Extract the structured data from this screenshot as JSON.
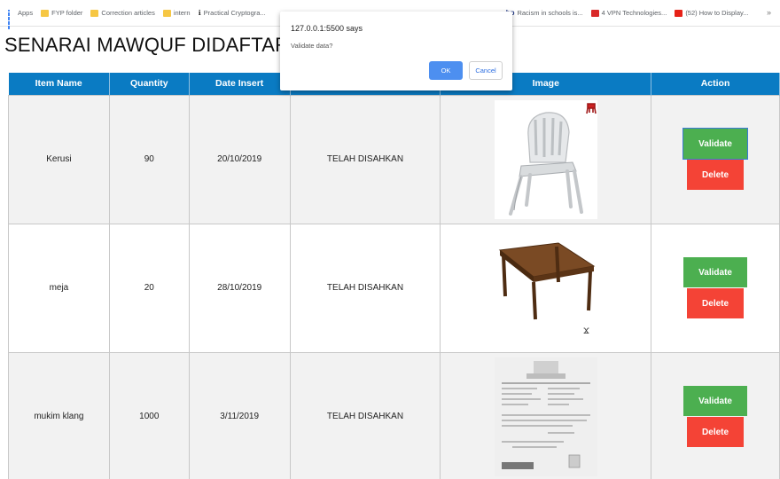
{
  "bookmarks": [
    {
      "label": "Apps",
      "icon": "apps-icon"
    },
    {
      "label": "FYP folder",
      "icon": "folder-icon"
    },
    {
      "label": "Correction articles",
      "icon": "folder-icon"
    },
    {
      "label": "intern",
      "icon": "folder-icon"
    },
    {
      "label": "Practical Cryptogra...",
      "icon": "tk-icon"
    },
    {
      "label": "Racism in schools is...",
      "icon": "bp-icon"
    },
    {
      "label": "4 VPN Technologies...",
      "icon": "it-icon"
    },
    {
      "label": "(52) How to Display...",
      "icon": "youtube-icon"
    }
  ],
  "bookmarks_more": "»",
  "page": {
    "title": "SENARAI MAWQUF DIDAFTAR"
  },
  "table": {
    "headers": [
      "Item Name",
      "Quantity",
      "Date Insert",
      "",
      "Image",
      "Action"
    ],
    "rows": [
      {
        "name": "Kerusi",
        "quantity": "90",
        "date": "20/10/2019",
        "status": "TELAH DISAHKAN",
        "image": "chair"
      },
      {
        "name": "meja",
        "quantity": "20",
        "date": "28/10/2019",
        "status": "TELAH DISAHKAN",
        "image": "table"
      },
      {
        "name": "mukim klang",
        "quantity": "1000",
        "date": "3/11/2019",
        "status": "TELAH DISAHKAN",
        "image": "document"
      }
    ],
    "validate_label": "Validate",
    "delete_label": "Delete"
  },
  "dialog": {
    "origin": "127.0.0.1:5500 says",
    "message": "Validate data?",
    "ok_label": "OK",
    "cancel_label": "Cancel"
  },
  "colors": {
    "header_bg": "#0a7bc3",
    "validate": "#4caf50",
    "delete": "#f44336",
    "ok": "#4d8ff0"
  }
}
